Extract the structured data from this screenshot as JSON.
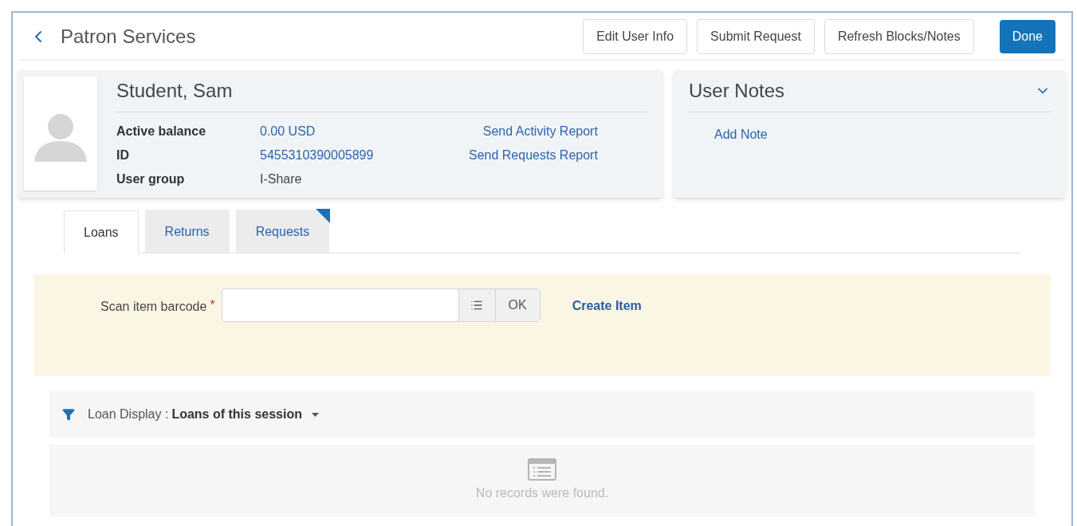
{
  "header": {
    "title": "Patron Services",
    "buttons": [
      {
        "label": "Edit User Info",
        "kind": "plain"
      },
      {
        "label": "Submit Request",
        "kind": "plain"
      },
      {
        "label": "Refresh Blocks/Notes",
        "kind": "plain"
      },
      {
        "label": "Done",
        "kind": "primary"
      }
    ]
  },
  "user_card": {
    "name": "Student, Sam",
    "fields": [
      {
        "label": "Active balance",
        "value": "0.00 USD",
        "link": true
      },
      {
        "label": "ID",
        "value": "5455310390005899",
        "link": true
      },
      {
        "label": "User group",
        "value": "I-Share",
        "link": false
      }
    ],
    "actions": [
      "Send Activity Report",
      "Send Requests Report"
    ]
  },
  "user_notes": {
    "title": "User Notes",
    "expanded": true,
    "action": "Add Note"
  },
  "tabs": [
    {
      "label": "Loans",
      "selected": true,
      "flagged": false
    },
    {
      "label": "Returns",
      "selected": false,
      "flagged": false
    },
    {
      "label": "Requests",
      "selected": false,
      "flagged": true
    }
  ],
  "scan": {
    "label": "Scan item barcode",
    "required_mark": "*",
    "ok": "OK",
    "create": "Create Item"
  },
  "loan_display": {
    "label": "Loan Display :",
    "value": "Loans of this session"
  },
  "empty_message": "No records were found."
}
